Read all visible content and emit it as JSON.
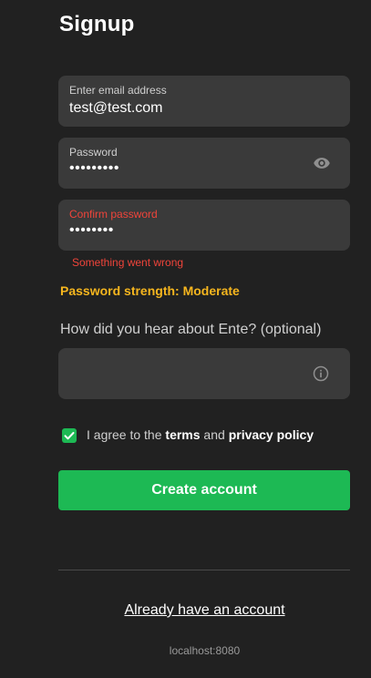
{
  "title": "Signup",
  "email": {
    "label": "Enter email address",
    "value": "test@test.com"
  },
  "password": {
    "label": "Password",
    "value": "•••••••••"
  },
  "confirm": {
    "label": "Confirm password",
    "value": "••••••••"
  },
  "error_message": "Something went wrong",
  "strength": "Password strength: Moderate",
  "referral": {
    "label": "How did you hear about Ente? (optional)",
    "value": ""
  },
  "agree": {
    "checked": true,
    "prefix": "I agree to the ",
    "terms": "terms",
    "and": " and ",
    "privacy": "privacy policy"
  },
  "create_button": "Create account",
  "login_link": "Already have an account",
  "host": "localhost:8080",
  "colors": {
    "background": "#212121",
    "field": "#3a3a3a",
    "accent_green": "#1db954",
    "error_red": "#f0443a",
    "strength_amber": "#f6b61e"
  },
  "icons": {
    "password_toggle": "eye-icon",
    "referral_help": "info-icon",
    "checkbox": "check-icon"
  }
}
